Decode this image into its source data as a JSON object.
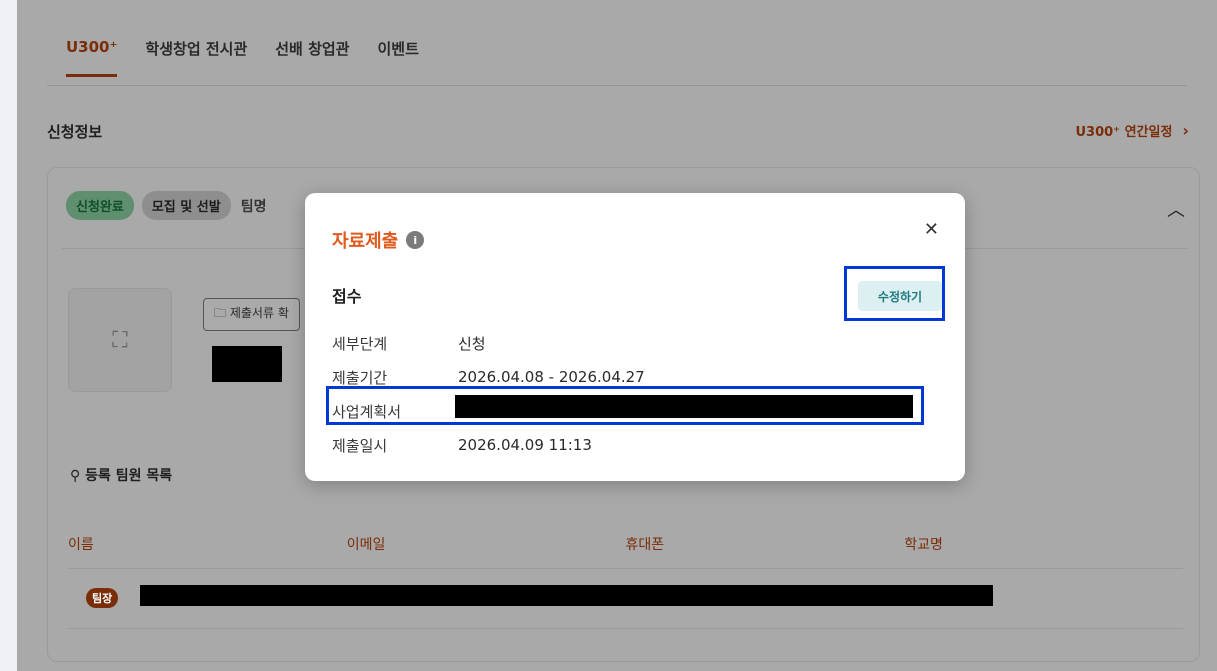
{
  "tabs": [
    {
      "label": "U300⁺",
      "active": true
    },
    {
      "label": "학생창업 전시관",
      "active": false
    },
    {
      "label": "선배 창업관",
      "active": false
    },
    {
      "label": "이벤트",
      "active": false
    }
  ],
  "section": {
    "title": "신청정보",
    "schedule_link": "U300⁺ 연간일정"
  },
  "card": {
    "badges": [
      "신청완료",
      "모집 및 선발"
    ],
    "team_label": "팀명",
    "docs_button": "제출서류 확",
    "members_title": "등록 팀원 목록",
    "columns": [
      "이름",
      "이메일",
      "휴대폰",
      "학교명"
    ],
    "leader_badge": "팀장"
  },
  "modal": {
    "title": "자료제출",
    "stage": "접수",
    "edit_button": "수정하기",
    "rows": [
      {
        "key": "세부단계",
        "value": "신청"
      },
      {
        "key": "제출기간",
        "value": "2026.04.08 - 2026.04.27"
      },
      {
        "key": "사업계획서",
        "value": ""
      },
      {
        "key": "제출일시",
        "value": "2026.04.09 11:13"
      }
    ]
  },
  "icons": [
    "info-icon",
    "close-icon",
    "chevron-right-icon",
    "chevron-up-icon",
    "folder-icon",
    "image-placeholder-icon",
    "user-icon"
  ]
}
